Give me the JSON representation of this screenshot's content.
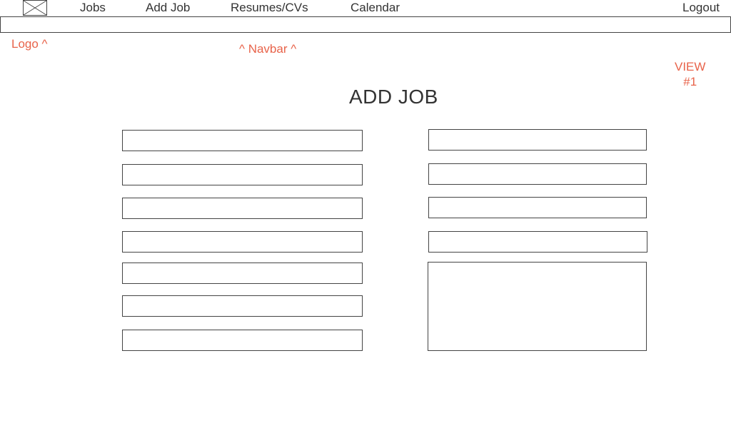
{
  "logo": {
    "icon": "image-placeholder-icon"
  },
  "nav": {
    "items": [
      "Jobs",
      "Add Job",
      "Resumes/CVs",
      "Calendar"
    ],
    "logout_label": "Logout"
  },
  "annotations": {
    "logo": "Logo ^",
    "navbar": "^ Navbar ^",
    "view_line1": "VIEW",
    "view_line2": "#1"
  },
  "page": {
    "title": "ADD JOB"
  },
  "form": {
    "left_fields": [
      "",
      "",
      "",
      "",
      "",
      "",
      ""
    ],
    "right_fields": [
      "",
      "",
      "",
      ""
    ],
    "textarea": ""
  },
  "colors": {
    "annotation": "#e8634a",
    "border": "#444444",
    "text": "#333333"
  }
}
